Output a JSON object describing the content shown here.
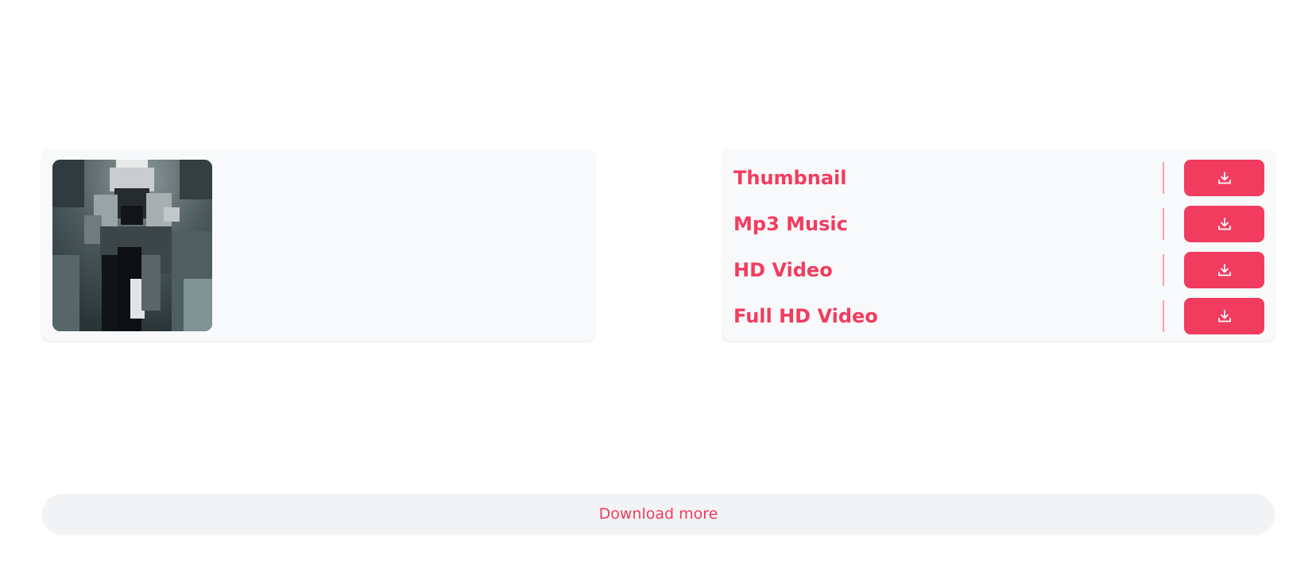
{
  "media": {
    "thumbnail_alt": "video thumbnail"
  },
  "options": [
    {
      "label": "Thumbnail",
      "icon": "download-icon"
    },
    {
      "label": "Mp3 Music",
      "icon": "download-icon"
    },
    {
      "label": "HD Video",
      "icon": "download-icon"
    },
    {
      "label": "Full HD Video",
      "icon": "download-icon"
    }
  ],
  "footer": {
    "download_more_label": "Download more"
  },
  "colors": {
    "accent": "#f23c5f",
    "card_bg": "#f8f9fa",
    "bar_bg": "#f2f3f5"
  }
}
